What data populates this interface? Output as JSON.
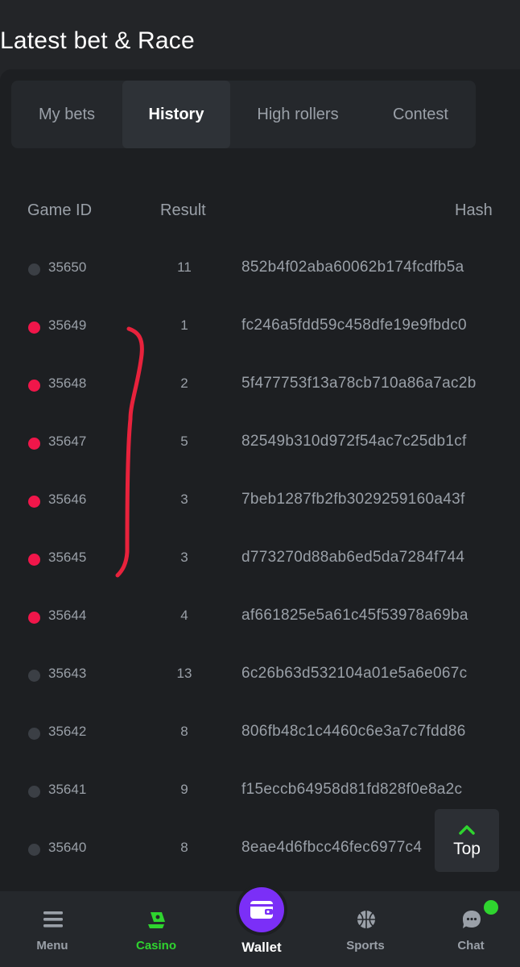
{
  "header": {
    "title": "Latest bet & Race"
  },
  "tabs": [
    {
      "label": "My bets",
      "active": false
    },
    {
      "label": "History",
      "active": true
    },
    {
      "label": "High rollers",
      "active": false
    },
    {
      "label": "Contest",
      "active": false
    }
  ],
  "table": {
    "columns": {
      "game_id": "Game ID",
      "result": "Result",
      "hash": "Hash"
    },
    "rows": [
      {
        "game_id": "35650",
        "result": "11",
        "hash": "852b4f02aba60062b174fcdfb5a",
        "status": "grey"
      },
      {
        "game_id": "35649",
        "result": "1",
        "hash": "fc246a5fdd59c458dfe19e9fbdc0",
        "status": "red"
      },
      {
        "game_id": "35648",
        "result": "2",
        "hash": "5f477753f13a78cb710a86a7ac2b",
        "status": "red"
      },
      {
        "game_id": "35647",
        "result": "5",
        "hash": "82549b310d972f54ac7c25db1cf",
        "status": "red"
      },
      {
        "game_id": "35646",
        "result": "3",
        "hash": "7beb1287fb2fb3029259160a43f",
        "status": "red"
      },
      {
        "game_id": "35645",
        "result": "3",
        "hash": "d773270d88ab6ed5da7284f744",
        "status": "red"
      },
      {
        "game_id": "35644",
        "result": "4",
        "hash": "af661825e5a61c45f53978a69ba",
        "status": "red"
      },
      {
        "game_id": "35643",
        "result": "13",
        "hash": "6c26b63d532104a01e5a6e067c",
        "status": "grey"
      },
      {
        "game_id": "35642",
        "result": "8",
        "hash": "806fb48c1c4460c6e3a7c7fdd86",
        "status": "grey"
      },
      {
        "game_id": "35641",
        "result": "9",
        "hash": "f15eccb64958d81fd828f0e8a2c",
        "status": "grey"
      },
      {
        "game_id": "35640",
        "result": "8",
        "hash": "8eae4d6fbcc46fec6977c4",
        "status": "grey"
      }
    ]
  },
  "status_colors": {
    "red": "#f0164a",
    "grey": "#3b3f45"
  },
  "top_button": {
    "label": "Top",
    "icon": "chevron-up-icon"
  },
  "bottom_nav": {
    "menu": {
      "label": "Menu",
      "icon": "menu-icon"
    },
    "casino": {
      "label": "Casino",
      "icon": "casino-icon"
    },
    "wallet": {
      "label": "Wallet",
      "icon": "wallet-icon"
    },
    "sports": {
      "label": "Sports",
      "icon": "basketball-icon"
    },
    "chat": {
      "label": "Chat",
      "icon": "chat-icon"
    }
  },
  "colors": {
    "accent_green": "#2fd42f",
    "wallet_purple": "#7b2ff7",
    "annotation_red": "#e8223c"
  }
}
